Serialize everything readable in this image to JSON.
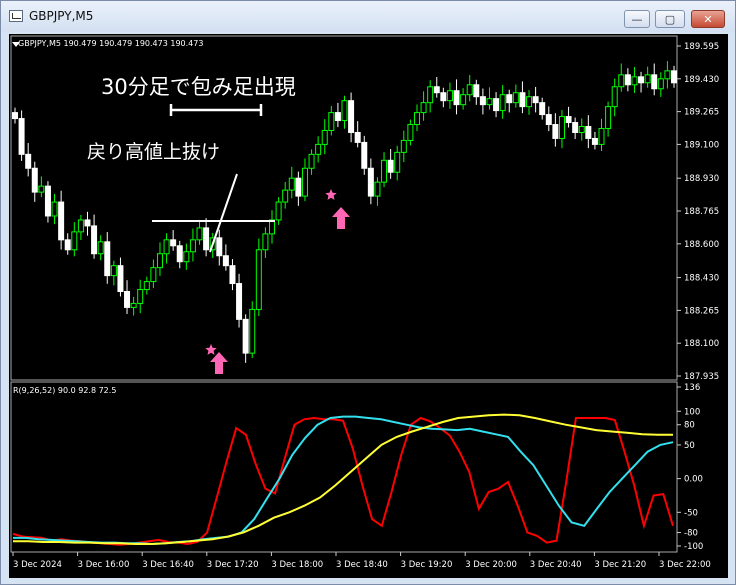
{
  "window": {
    "title": "GBPJPY,M5",
    "buttons": {
      "minimize": "—",
      "maximize": "▢",
      "close": "✕"
    }
  },
  "chart": {
    "symbol_label": "GBPJPY,M5 190.479 190.479 190.473 190.473",
    "price_axis": [
      "189.595",
      "189.430",
      "189.265",
      "189.100",
      "188.930",
      "188.765",
      "188.600",
      "188.430",
      "188.265",
      "188.100",
      "187.935"
    ],
    "indicator_label": "R(9,26,52) 90.0 92.8 72.5",
    "indicator_axis": [
      "136",
      "100",
      "80",
      "50",
      "0.00",
      "-50",
      "-80",
      "-100"
    ],
    "time_axis": [
      "3 Dec 2024",
      "3 Dec 16:00",
      "3 Dec 16:40",
      "3 Dec 17:20",
      "3 Dec 18:00",
      "3 Dec 18:40",
      "3 Dec 19:20",
      "3 Dec 20:00",
      "3 Dec 20:40",
      "3 Dec 21:20",
      "3 Dec 22:00"
    ],
    "annotations": {
      "pattern": "30分足で包み足出現",
      "breakout": "戻り高値上抜け"
    },
    "colors": {
      "background": "#000000",
      "bull_candle": "#00ff00",
      "bear_candle": "#ffffff",
      "line_red": "#ff0000",
      "line_cyan": "#33e0ee",
      "line_yellow": "#ffff33",
      "marker": "#ff66b3"
    }
  },
  "chart_data": {
    "type": "candlestick",
    "symbol": "GBPJPY",
    "timeframe": "M5",
    "last_quote": {
      "open": 190.479,
      "high": 190.479,
      "low": 190.473,
      "close": 190.473
    },
    "price_range": [
      187.935,
      189.595
    ],
    "closes": [
      189.23,
      189.05,
      188.98,
      188.86,
      188.89,
      188.74,
      188.81,
      188.62,
      188.57,
      188.66,
      188.72,
      188.69,
      188.55,
      188.61,
      188.44,
      188.49,
      188.36,
      188.28,
      188.3,
      188.37,
      188.41,
      188.48,
      188.55,
      188.62,
      188.59,
      188.51,
      188.56,
      188.62,
      188.68,
      188.57,
      188.63,
      188.54,
      188.49,
      188.4,
      188.22,
      188.05,
      188.27,
      188.57,
      188.65,
      188.72,
      188.81,
      188.87,
      188.93,
      188.84,
      188.98,
      189.05,
      189.1,
      189.17,
      189.26,
      189.22,
      189.32,
      189.16,
      189.11,
      188.98,
      188.84,
      188.91,
      189.02,
      188.96,
      189.06,
      189.12,
      189.2,
      189.26,
      189.31,
      189.39,
      189.36,
      189.32,
      189.37,
      189.3,
      189.35,
      189.4,
      189.34,
      189.3,
      189.33,
      189.27,
      189.35,
      189.31,
      189.36,
      189.29,
      189.34,
      189.31,
      189.25,
      189.2,
      189.13,
      189.24,
      189.21,
      189.16,
      189.19,
      189.13,
      189.1,
      189.18,
      189.29,
      189.39,
      189.45,
      189.4,
      189.44,
      189.41,
      189.45,
      189.38,
      189.43,
      189.47,
      189.41
    ],
    "indicator": {
      "name": "R(9,26,52)",
      "values": [
        90.0,
        92.8,
        72.5
      ],
      "range": [
        -100,
        136
      ],
      "series": [
        {
          "name": "R9",
          "color": "#ff0000",
          "values": [
            -82,
            -86,
            -87,
            -88,
            -92,
            -90,
            -92,
            -93,
            -95,
            -96,
            -97,
            -98,
            -97,
            -95,
            -93,
            -91,
            -94,
            -95,
            -97,
            -94,
            -80,
            -28,
            25,
            75,
            65,
            22,
            -15,
            -22,
            30,
            80,
            88,
            90,
            88,
            88,
            86,
            45,
            -10,
            -60,
            -70,
            -20,
            35,
            80,
            90,
            85,
            75,
            64,
            40,
            10,
            -45,
            -20,
            -15,
            -5,
            -40,
            -80,
            -85,
            -95,
            -92,
            -5,
            90,
            90,
            90,
            90,
            87,
            40,
            -10,
            -70,
            -25,
            -23,
            -70
          ],
          "note": ""
        },
        {
          "name": "R26",
          "color": "#33e0ee",
          "values": [
            -88,
            -88,
            -90,
            -91,
            -92,
            -93,
            -94,
            -95,
            -95,
            -96,
            -96,
            -97,
            -96,
            -94,
            -93,
            -90,
            -88,
            -86,
            -80,
            -60,
            -30,
            0,
            35,
            60,
            80,
            90,
            92,
            92,
            90,
            88,
            84,
            80,
            76,
            74,
            73,
            72,
            74,
            70,
            66,
            62,
            40,
            20,
            -10,
            -40,
            -65,
            -70,
            -45,
            -20,
            0,
            20,
            40,
            50,
            54
          ],
          "note": ""
        },
        {
          "name": "R52",
          "color": "#ffff33",
          "values": [
            -93,
            -93,
            -94,
            -94,
            -95,
            -95,
            -96,
            -96,
            -97,
            -97,
            -96,
            -94,
            -92,
            -90,
            -86,
            -80,
            -70,
            -58,
            -50,
            -40,
            -28,
            -10,
            10,
            30,
            50,
            62,
            70,
            77,
            84,
            90,
            92,
            94,
            95,
            94,
            90,
            85,
            80,
            76,
            72,
            70,
            68,
            66,
            65,
            65
          ],
          "note": ""
        }
      ]
    },
    "markers": [
      {
        "type": "star",
        "price": 188.1,
        "label": ""
      },
      {
        "type": "star",
        "price": 188.84,
        "label": ""
      },
      {
        "type": "up-arrow",
        "label": ""
      },
      {
        "type": "up-arrow",
        "label": ""
      }
    ]
  }
}
